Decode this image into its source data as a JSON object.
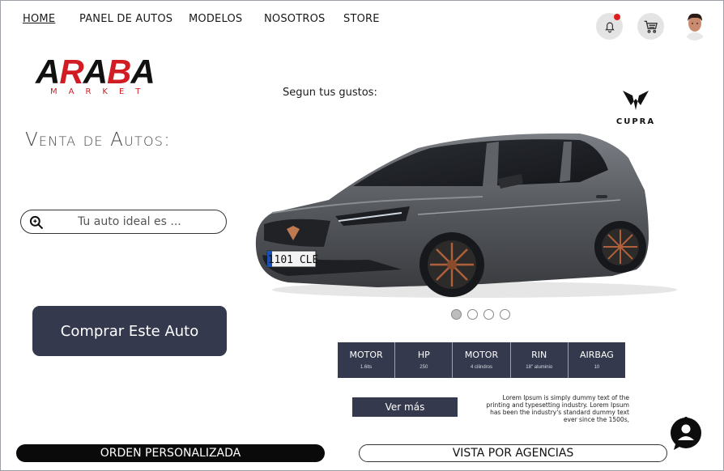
{
  "nav": {
    "items": [
      {
        "label": "HOME"
      },
      {
        "label": "PANEL DE AUTOS"
      },
      {
        "label": "MODELOS"
      },
      {
        "label": "NOSOTROS"
      },
      {
        "label": "STORE"
      }
    ]
  },
  "header": {
    "bell_icon": "bell-icon",
    "cart_icon": "cart-icon",
    "has_notification": true
  },
  "brand": {
    "logo_text": "ARABA",
    "logo_sub": "MARKET",
    "cupra_text": "CUPRA"
  },
  "hero": {
    "gustos_label": "Segun tus gustos:",
    "venta_title": "Venta de Autos:",
    "search_placeholder": "Tu auto ideal es ...",
    "plate": "1101 CLE",
    "buy_button": "Comprar Este Auto",
    "carousel_count": 4,
    "carousel_active": 1
  },
  "specs": [
    {
      "title": "MOTOR",
      "value": "1.6lts"
    },
    {
      "title": "HP",
      "value": "250"
    },
    {
      "title": "MOTOR",
      "value": "4 cilindros"
    },
    {
      "title": "RIN",
      "value": "18\" aluminio"
    },
    {
      "title": "AIRBAG",
      "value": "10"
    }
  ],
  "details": {
    "ver_mas": "Ver más",
    "lorem": "Lorem Ipsum is simply dummy text of the printing and typesetting industry. Lorem Ipsum has been the industry's standard dummy text ever since the 1500s,"
  },
  "footer": {
    "orden": "ORDEN PERSONALIZADA",
    "vista": "VISTA POR AGENCIAS"
  },
  "colors": {
    "primary": "#34394d",
    "accent_red": "#d11c24"
  }
}
